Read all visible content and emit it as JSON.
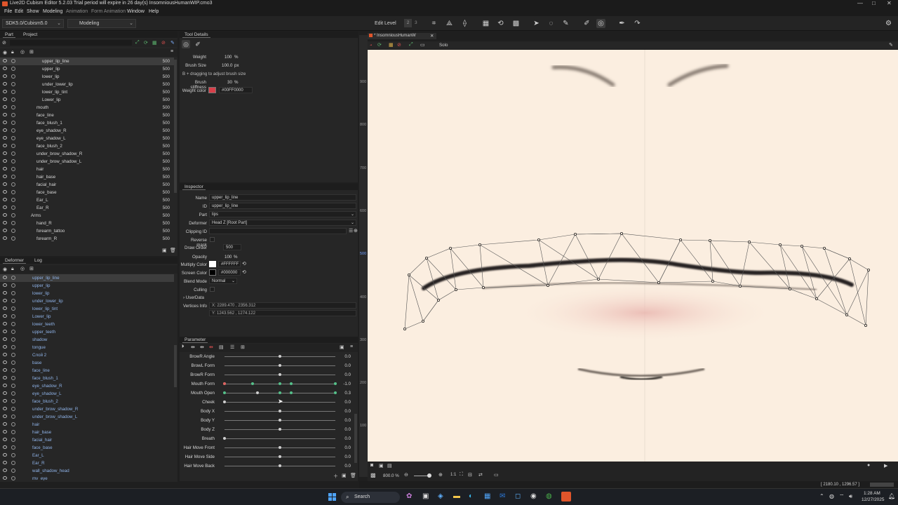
{
  "titlebar": {
    "text": "Live2D Cubism Editor 5.2.03   Trial period will expire in 26 day(s)   InsomniousHumanWIP.cmo3",
    "minimize": "—",
    "maximize": "□",
    "close": "✕"
  },
  "menu": [
    "File",
    "Edit",
    "Show",
    "Modeling",
    "Animation",
    "Form Animation",
    "Window",
    "Help"
  ],
  "toolbar": {
    "sdk": "SDK5.0/Cubism5.0",
    "mode": "Modeling",
    "edit_level_label": "Edit Level",
    "edit_levels": [
      "2",
      "3"
    ]
  },
  "part_panel": {
    "tabs": [
      "Part",
      "Project"
    ],
    "rows": [
      {
        "label": "upper_lip_line",
        "num": "500",
        "indent": 60,
        "selected": true
      },
      {
        "label": "upper_lip",
        "num": "500",
        "indent": 60
      },
      {
        "label": "lower_lip",
        "num": "500",
        "indent": 60
      },
      {
        "label": "under_lower_lip",
        "num": "500",
        "indent": 60
      },
      {
        "label": "lower_lip_tint",
        "num": "500",
        "indent": 60
      },
      {
        "label": "Lower_lip",
        "num": "500",
        "indent": 60
      },
      {
        "label": "mouth",
        "num": "500",
        "indent": 52
      },
      {
        "label": "face_line",
        "num": "500",
        "indent": 52
      },
      {
        "label": "face_blush_1",
        "num": "500",
        "indent": 52
      },
      {
        "label": "eye_shadow_R",
        "num": "500",
        "indent": 52
      },
      {
        "label": "eye_shadow_L",
        "num": "500",
        "indent": 52
      },
      {
        "label": "face_blush_2",
        "num": "500",
        "indent": 52
      },
      {
        "label": "under_brow_shadow_R",
        "num": "500",
        "indent": 52
      },
      {
        "label": "under_brow_shadow_L",
        "num": "500",
        "indent": 52
      },
      {
        "label": "hair",
        "num": "500",
        "indent": 52
      },
      {
        "label": "hair_base",
        "num": "500",
        "indent": 52
      },
      {
        "label": "facial_hair",
        "num": "500",
        "indent": 52
      },
      {
        "label": "face_base",
        "num": "500",
        "indent": 52
      },
      {
        "label": "Ear_L",
        "num": "500",
        "indent": 52
      },
      {
        "label": "Ear_R",
        "num": "500",
        "indent": 52
      },
      {
        "label": "Arms",
        "num": "500",
        "indent": 44
      },
      {
        "label": "hand_R",
        "num": "500",
        "indent": 52
      },
      {
        "label": "forearm_tattoo",
        "num": "500",
        "indent": 52
      },
      {
        "label": "forearm_R",
        "num": "500",
        "indent": 52
      }
    ]
  },
  "deformer_panel": {
    "tabs": [
      "Deformer",
      "Log"
    ],
    "rows": [
      "upper_lip_line",
      "upper_lip",
      "lower_lip",
      "under_lower_lip",
      "lower_lip_tint",
      "Lower_lip",
      "lower_teeth",
      "upper_teeth",
      "shadow",
      "tongue",
      "Слой 2",
      "base",
      "face_line",
      "face_blush_1",
      "eye_shadow_R",
      "eye_shadow_L",
      "face_blush_2",
      "under_brow_shadow_R",
      "under_brow_shadow_L",
      "hair",
      "hair_base",
      "facial_hair",
      "face_base",
      "Ear_L",
      "Ear_R",
      "wall_shadow_head",
      "mv_eye"
    ]
  },
  "tool_details": {
    "tab": "Tool Details",
    "weight_label": "Weight",
    "weight_value": "100",
    "weight_unit": "%",
    "brush_size_label": "Brush Size",
    "brush_size_value": "100.0",
    "brush_size_unit": "px",
    "hint": "B + dragging to adjust brush size",
    "stiffness_label": "Brush stiffness",
    "stiffness_value": "30",
    "stiffness_unit": "%",
    "weight_color_label": "Weight color",
    "weight_color_value": "#00FF0000",
    "weight_color_swatch": "#d8404a"
  },
  "inspector": {
    "tab": "Inspector",
    "name_label": "Name",
    "name": "upper_lip_line",
    "id_label": "ID",
    "id": "upper_lip_line",
    "part_label": "Part",
    "part": "lips",
    "deformer_label": "Deformer",
    "deformer": "Head Z  [Root Part]",
    "clipping_label": "Clipping ID",
    "clipping": "",
    "reverse_mask_label": "Reverse mask",
    "draw_order_label": "Draw Order",
    "draw_order": "500",
    "opacity_label": "Opacity",
    "opacity": "100",
    "opacity_unit": "%",
    "multiply_label": "Multiply Color",
    "multiply": "#FFFFFF",
    "screen_label": "Screen Color",
    "screen": "#000000",
    "blend_label": "Blend Mode",
    "blend": "Normal",
    "culling_label": "Culling",
    "userdata_label": "UserData",
    "vertices_label": "Vertices Info",
    "vertices_x": "X: 2289.470 , 2356.312",
    "vertices_y": "Y: 1243.562 , 1274.122"
  },
  "parameters": {
    "tab": "Parameter",
    "rows": [
      {
        "name": "BrowR Angle",
        "value": "0.0",
        "pos": 0.5
      },
      {
        "name": "BrowL Form",
        "value": "0.0",
        "pos": 0.5
      },
      {
        "name": "BrowR Form",
        "value": "0.0",
        "pos": 0.5
      },
      {
        "name": "Mouth Form",
        "value": "-1.0",
        "pos": 0.0,
        "keys": [
          0.0,
          0.25,
          0.5,
          0.6,
          1.0
        ]
      },
      {
        "name": "Mouth Open",
        "value": "0.3",
        "pos": 0.3,
        "keys": [
          0.0,
          0.5,
          0.6,
          1.0
        ]
      },
      {
        "name": "Cheek",
        "value": "0.0",
        "pos": 0.0
      },
      {
        "name": "Body X",
        "value": "0.0",
        "pos": 0.5
      },
      {
        "name": "Body Y",
        "value": "0.0",
        "pos": 0.5
      },
      {
        "name": "Body Z",
        "value": "0.0",
        "pos": 0.5
      },
      {
        "name": "Breath",
        "value": "0.0",
        "pos": 0.0
      },
      {
        "name": "Hair Move Front",
        "value": "0.0",
        "pos": 0.5
      },
      {
        "name": "Hair Move Side",
        "value": "0.0",
        "pos": 0.5
      },
      {
        "name": "Hair Move Back",
        "value": "0.0",
        "pos": 0.5
      }
    ]
  },
  "viewport": {
    "tab": "InsomniousHumanW",
    "solo": "Solo",
    "ruler": [
      "900",
      "800",
      "700",
      "600",
      "500",
      "400",
      "300",
      "200",
      "100"
    ],
    "zoom": "800.0 %",
    "coords": "[ 2180.10 , 1296.57 ]"
  },
  "taskbar": {
    "search": "Search",
    "time": "1:28 AM",
    "date": "12/27/2025"
  }
}
